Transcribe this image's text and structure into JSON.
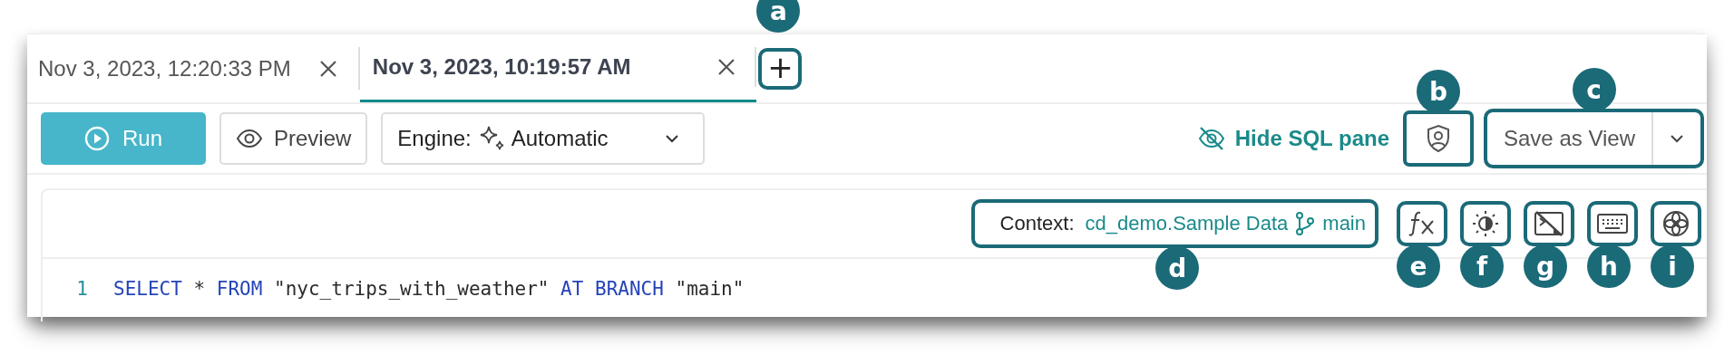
{
  "tabs": [
    {
      "label": "Nov 3, 2023, 12:20:33 PM",
      "selected": false
    },
    {
      "label": "Nov 3, 2023, 10:19:57 AM",
      "selected": true
    }
  ],
  "new_tab": {
    "label": "+",
    "callout": "a"
  },
  "toolbar": {
    "run": "Run",
    "preview": "Preview",
    "engine_label": "Engine:",
    "engine_value": "Automatic",
    "hide_sql": "Hide SQL pane",
    "privacy": {
      "callout": "b"
    },
    "save": {
      "label": "Save as View",
      "callout": "c"
    }
  },
  "editor": {
    "context": {
      "label": "Context:",
      "source": "cd_demo.Sample Data",
      "branch": "main",
      "callout": "d"
    },
    "tools": [
      {
        "kind": "function",
        "callout": "e"
      },
      {
        "kind": "theme",
        "callout": "f"
      },
      {
        "kind": "terminal-off",
        "callout": "g"
      },
      {
        "kind": "keyboard",
        "callout": "h"
      },
      {
        "kind": "flower",
        "callout": "i"
      }
    ],
    "lines": [
      {
        "number": "1",
        "tokens": [
          {
            "kind": "keyword",
            "text": "SELECT"
          },
          {
            "kind": "plain",
            "text": " * "
          },
          {
            "kind": "keyword",
            "text": "FROM"
          },
          {
            "kind": "plain",
            "text": " \"nyc_trips_with_weather\" "
          },
          {
            "kind": "keyword",
            "text": "AT BRANCH"
          },
          {
            "kind": "plain",
            "text": " \"main\""
          }
        ]
      }
    ]
  }
}
